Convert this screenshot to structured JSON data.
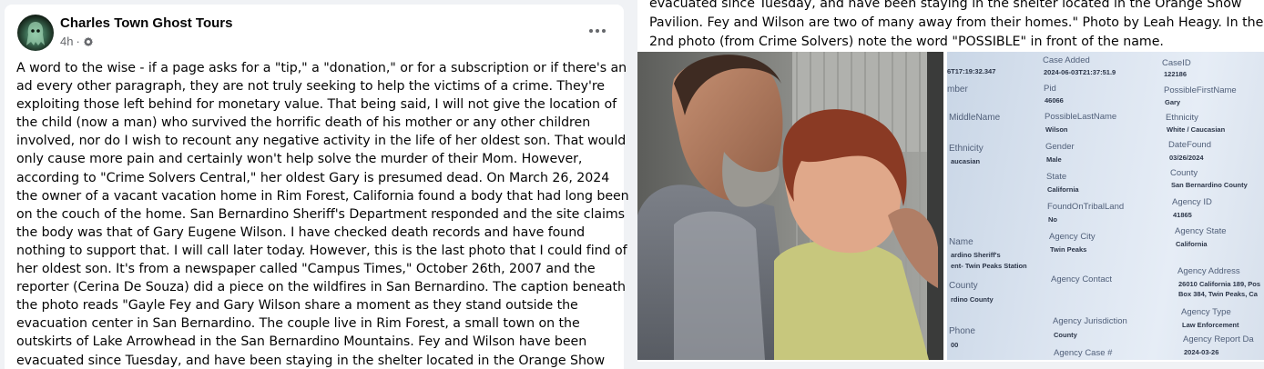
{
  "post": {
    "page_name": "Charles Town Ghost Tours",
    "time": "4h",
    "separator": "·",
    "privacy_icon": "gear-icon",
    "more_icon": "more-options-icon",
    "body_lines": [
      "A word to the wise - if a page asks for a \"tip,\" a \"donation,\" or for a subscription or if there's an",
      "ad every other paragraph, they are not truly seeking to help the victims of a crime. They're",
      "exploiting those left behind for monetary value. That being said, I will not give the location of",
      "the child (now a man) who survived the horrific death of his mother or any other children",
      "involved, nor do I wish to recount any negative activity in the life of her oldest son. That would",
      "only cause more pain and certainly won't help solve the murder of their Mom. However,",
      "according to \"Crime Solvers Central,\" her oldest Gary is presumed dead. On March 26, 2024",
      "the owner of a vacant vacation home in Rim Forest, California found a body that had long been",
      "on the couch of the home. San Bernardino Sheriff's Department responded and the site claims",
      "the body was that of Gary Eugene Wilson. I have checked death records and have found",
      "nothing to support that. I will call later today. However, this is the last photo that I could find of",
      "her oldest son. It's from a newspaper called \"Campus Times,\" October 26th, 2007 and the",
      "reporter (Cerina De Souza) did a piece on the wildfires in San Bernardino. The caption beneath",
      "the photo reads \"Gayle Fey and Gary Wilson share a moment as they stand outside the",
      "evacuation center in San Bernardino. The couple live in Rim Forest, a small town on the",
      "outskirts of Lake Arrowhead in the San Bernardino Mountains. Fey and Wilson have been",
      "evacuated since Tuesday, and  have been staying in the shelter located in the Orange Show"
    ]
  },
  "right": {
    "text_lines": [
      "evacuated since Tuesday, and  have been staying in the shelter located in the Orange Show",
      "Pavilion. Fey and Wilson are two of many away from their homes.\" Photo by Leah Heagy. In the",
      "2nd photo (from Crime Solvers) note the word \"POSSIBLE\" in front of the name."
    ]
  },
  "record": {
    "case_added_label": "Case Added",
    "case_added_value": "2024-06-03T21:37:51.9",
    "caseid_label": "CaseID",
    "caseid_value": "122186",
    "left_ts": "6T17:19:32.347",
    "number_label": "mber",
    "pid_label": "Pid",
    "pid_value": "46066",
    "first_label": "PossibleFirstName",
    "first_value": "Gary",
    "middle_label": "MiddleName",
    "last_label": "PossibleLastName",
    "last_value": "Wilson",
    "ethnicity_label": "Ethnicity",
    "ethnicity_value": "White / Caucasian",
    "ethnicity2_label": "Ethnicity",
    "ethnicity2_value": "aucasian",
    "gender_label": "Gender",
    "gender_value": "Male",
    "datefound_label": "DateFound",
    "datefound_value": "03/26/2024",
    "state_label": "State",
    "state_value": "California",
    "county_label": "County",
    "county_value": "San Bernardino County",
    "tribal_label": "FoundOnTribalLand",
    "tribal_value": "No",
    "agencyid_label": "Agency ID",
    "agencyid_value": "41865",
    "name_label": "Name",
    "name_value_1": "ardino Sheriff's",
    "name_value_2": "ent- Twin Peaks Station",
    "agencycity_label": "Agency City",
    "agencycity_value": "Twin Peaks",
    "agencystate_label": "Agency State",
    "agencystate_value": "California",
    "agencycontact_label": "Agency Contact",
    "agencyaddress_label": "Agency Address",
    "agencyaddress_value_1": "26010 California 189, Pos",
    "agencyaddress_value_2": "Box 384, Twin Peaks, Ca",
    "county2_label": "County",
    "county2_value": "rdino County",
    "agencyjur_label": "Agency Jurisdiction",
    "agencyjur_value": "County",
    "agencytype_label": "Agency Type",
    "agencytype_value": "Law Enforcement",
    "phone_label": "Phone",
    "phone_value": "00",
    "agencycase_label": "Agency Case #",
    "agencyreport_label": "Agency Report Da",
    "agencyreport_value": "2024-03-26"
  }
}
